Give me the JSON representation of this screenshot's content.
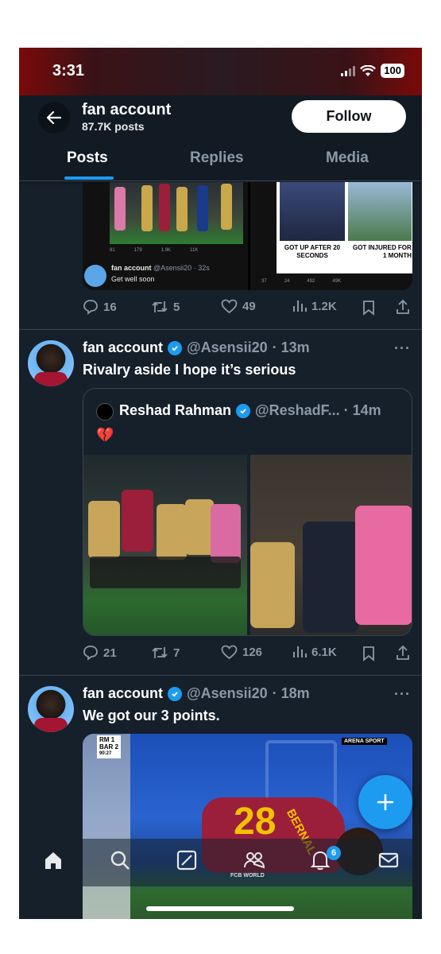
{
  "status_bar": {
    "time": "3:31",
    "battery": "100"
  },
  "header": {
    "account_name": "fan account",
    "post_count": "87.7K posts",
    "follow_label": "Follow"
  },
  "tabs": [
    {
      "label": "Posts",
      "active": true
    },
    {
      "label": "Replies",
      "active": false
    },
    {
      "label": "Media",
      "active": false
    }
  ],
  "post0": {
    "left_image": {
      "quoted_name": "fan account",
      "quoted_handle": "@Asensii20 · 32s",
      "quoted_text": "Get well soon",
      "mini_counts": [
        "81",
        "179",
        "1.9K",
        "11K"
      ]
    },
    "right_image": {
      "caption_left": "GOT UP AFTER 20 SECONDS",
      "caption_right": "GOT INJURED FOR",
      "caption_right_2": "1 MONTH",
      "mini_counts": [
        "37",
        "24",
        "492",
        "49K"
      ]
    },
    "actions": {
      "replies": "16",
      "reposts": "5",
      "likes": "49",
      "views": "1.2K"
    }
  },
  "post1": {
    "author": "fan account",
    "handle": "@Asensii20",
    "time": "· 13m",
    "text": "Rivalry aside I hope it’s serious",
    "quote": {
      "author": "Reshad Rahman",
      "handle": "@ReshadF... · 14m",
      "text": "💔"
    },
    "actions": {
      "replies": "21",
      "reposts": "7",
      "likes": "126",
      "views": "6.1K"
    }
  },
  "post2": {
    "author": "fan account",
    "handle": "@Asensii20",
    "time": "· 18m",
    "text": "We got our 3 points.",
    "scoreboard": {
      "team1": "RM",
      "score1": "1",
      "team2": "BAR",
      "score2": "2",
      "clock": "90:27"
    },
    "channel_tag": "ARENA SPORT",
    "shirt_name": "BERNAL",
    "shirt_number": "28",
    "watermark": "FCB WORLD"
  },
  "bottom_nav": {
    "notification_badge": "6"
  },
  "colors": {
    "background": "#15202b",
    "accent": "#1d9bf0",
    "muted": "#8b98a5",
    "divider": "#38444d"
  }
}
